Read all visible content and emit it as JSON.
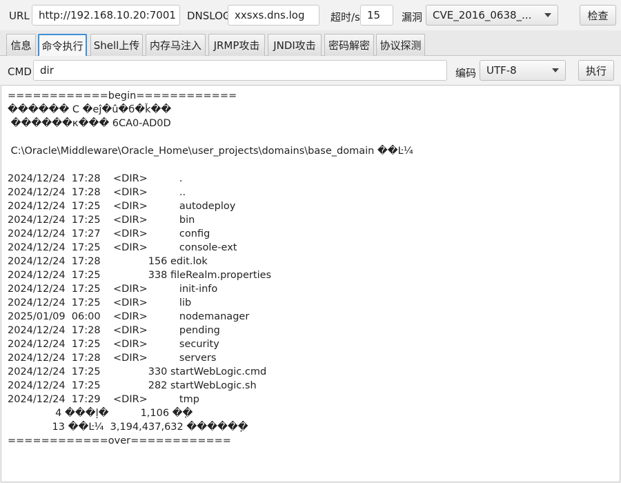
{
  "toolbar": {
    "url_label": "URL",
    "url_value": "http://192.168.10.20:7001",
    "dnslog_label": "DNSLOG",
    "dnslog_value": "xxsxs.dns.log",
    "timeout_label": "超时/s",
    "timeout_value": "15",
    "vuln_label": "漏洞",
    "vuln_selected": "CVE_2016_0638_...",
    "check_button": "检查"
  },
  "tabs": [
    {
      "label": "信息",
      "active": false
    },
    {
      "label": "命令执行",
      "active": true
    },
    {
      "label": "Shell上传",
      "active": false
    },
    {
      "label": "内存马注入",
      "active": false
    },
    {
      "label": "JRMP攻击",
      "active": false
    },
    {
      "label": "JNDI攻击",
      "active": false
    },
    {
      "label": "密码解密",
      "active": false
    },
    {
      "label": "协议探测",
      "active": false
    }
  ],
  "command": {
    "cmd_label": "CMD",
    "cmd_value": "dir",
    "encoding_label": "编码",
    "encoding_selected": "UTF-8",
    "run_button": "执行"
  },
  "output_lines": [
    "============begin============",
    "������ C �еĵ�û�б�ǩ��",
    " ������к��� 6CA0-AD0D",
    "",
    " C:\\Oracle\\Middleware\\Oracle_Home\\user_projects\\domains\\base_domain ��Ŀ¼",
    "",
    "2024/12/24  17:28    <DIR>          .",
    "2024/12/24  17:28    <DIR>          ..",
    "2024/12/24  17:25    <DIR>          autodeploy",
    "2024/12/24  17:25    <DIR>          bin",
    "2024/12/24  17:27    <DIR>          config",
    "2024/12/24  17:25    <DIR>          console-ext",
    "2024/12/24  17:28               156 edit.lok",
    "2024/12/24  17:25               338 fileRealm.properties",
    "2024/12/24  17:25    <DIR>          init-info",
    "2024/12/24  17:25    <DIR>          lib",
    "2025/01/09  06:00    <DIR>          nodemanager",
    "2024/12/24  17:28    <DIR>          pending",
    "2024/12/24  17:25    <DIR>          security",
    "2024/12/24  17:28    <DIR>          servers",
    "2024/12/24  17:25               330 startWebLogic.cmd",
    "2024/12/24  17:25               282 startWebLogic.sh",
    "2024/12/24  17:29    <DIR>          tmp",
    "               4 ���ļ�          1,106 �ֽ�",
    "              13 ��Ŀ¼  3,194,437,632 �����ֽ�",
    "============over============"
  ]
}
